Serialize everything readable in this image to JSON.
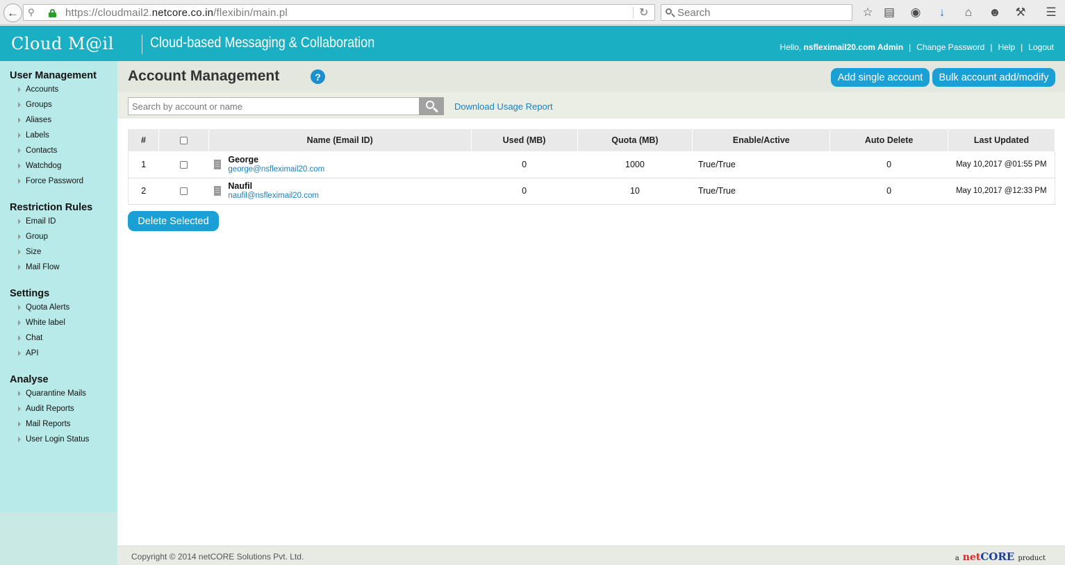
{
  "browser": {
    "url_prefix": "https://cloudmail2.",
    "url_host": "netcore.co.in",
    "url_path": "/flexibin/main.pl",
    "search_placeholder": "Search",
    "icons": [
      "back-icon",
      "key-icon",
      "lock-icon",
      "reload-icon",
      "search-icon",
      "star-icon",
      "reading-list-icon",
      "pocket-icon",
      "download-icon",
      "home-icon",
      "chat-icon",
      "extension-icon",
      "menu-icon"
    ]
  },
  "header": {
    "logo_text": "Cloud M@il",
    "tagline": "Cloud-based Messaging & Collaboration",
    "greeting": "Hello,",
    "user": "nsfleximail20.com Admin",
    "change_password": "Change Password",
    "help": "Help",
    "logout": "Logout",
    "brand_color": "#1bafc4"
  },
  "sidebar": {
    "sections": [
      {
        "title": "User Management",
        "items": [
          "Accounts",
          "Groups",
          "Aliases",
          "Labels",
          "Contacts",
          "Watchdog",
          "Force Password"
        ]
      },
      {
        "title": "Restriction Rules",
        "items": [
          "Email ID",
          "Group",
          "Size",
          "Mail Flow"
        ]
      },
      {
        "title": "Settings",
        "items": [
          "Quota Alerts",
          "White label",
          "Chat",
          "API"
        ]
      },
      {
        "title": "Analyse",
        "items": [
          "Quarantine Mails",
          "Audit Reports",
          "Mail Reports",
          "User Login Status"
        ]
      }
    ]
  },
  "main": {
    "title": "Account Management",
    "help_glyph": "?",
    "add_single": "Add single account",
    "bulk_add": "Bulk account add/modify",
    "search_placeholder": "Search by account or name",
    "download_report": "Download Usage Report",
    "delete_selected": "Delete Selected",
    "accent_color": "#1ba0d6"
  },
  "table": {
    "headers": [
      "#",
      "",
      "Name (Email ID)",
      "Used (MB)",
      "Quota (MB)",
      "Enable/Active",
      "Auto Delete",
      "Last Updated"
    ],
    "rows": [
      {
        "num": "1",
        "name": "George",
        "email": "george@nsfleximail20.com",
        "used": "0",
        "quota": "1000",
        "enable": "True/True",
        "auto_delete": "0",
        "updated": "May 10,2017 @01:55 PM"
      },
      {
        "num": "2",
        "name": "Naufil",
        "email": "naufil@nsfleximail20.com",
        "used": "0",
        "quota": "10",
        "enable": "True/True",
        "auto_delete": "0",
        "updated": "May 10,2017 @12:33 PM"
      }
    ]
  },
  "footer": {
    "copyright": "Copyright © 2014 netCORE Solutions Pvt. Ltd.",
    "brand_prefix": "a",
    "brand_net": "net",
    "brand_core": "CORE",
    "brand_suffix": "product"
  }
}
